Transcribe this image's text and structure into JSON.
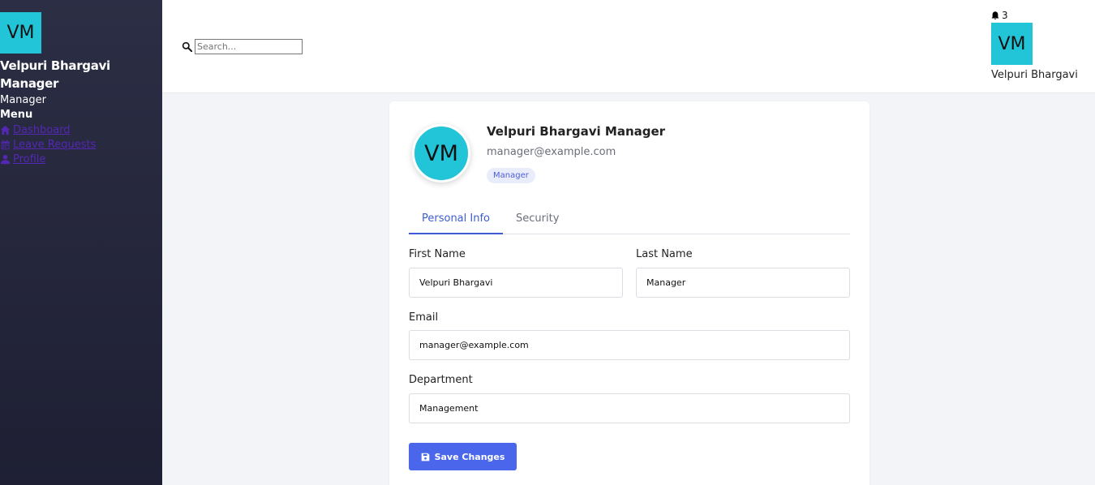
{
  "sidebar": {
    "avatar_initials": "VM",
    "user_name": "Velpuri Bhargavi Manager",
    "user_role": "Manager",
    "menu_title": "Menu",
    "items": [
      {
        "label": "Dashboard",
        "icon": "home-icon"
      },
      {
        "label": "Leave Requests",
        "icon": "calendar-icon"
      },
      {
        "label": "Profile",
        "icon": "user-icon"
      }
    ]
  },
  "header": {
    "search_placeholder": "Search...",
    "notification_count": "3",
    "avatar_initials": "VM",
    "user_name": "Velpuri Bhargavi"
  },
  "profile": {
    "avatar_initials": "VM",
    "full_name": "Velpuri Bhargavi Manager",
    "email": "manager@example.com",
    "role_badge": "Manager"
  },
  "tabs": [
    {
      "label": "Personal Info",
      "active": true
    },
    {
      "label": "Security",
      "active": false
    }
  ],
  "form": {
    "first_name_label": "First Name",
    "first_name_value": "Velpuri Bhargavi",
    "last_name_label": "Last Name",
    "last_name_value": "Manager",
    "email_label": "Email",
    "email_value": "manager@example.com",
    "department_label": "Department",
    "department_value": "Management",
    "save_label": "Save Changes"
  },
  "colors": {
    "accent": "#4a66ea",
    "avatar": "#22c4d8",
    "sidebar_bg": "#25273c",
    "link": "#5527b5"
  }
}
